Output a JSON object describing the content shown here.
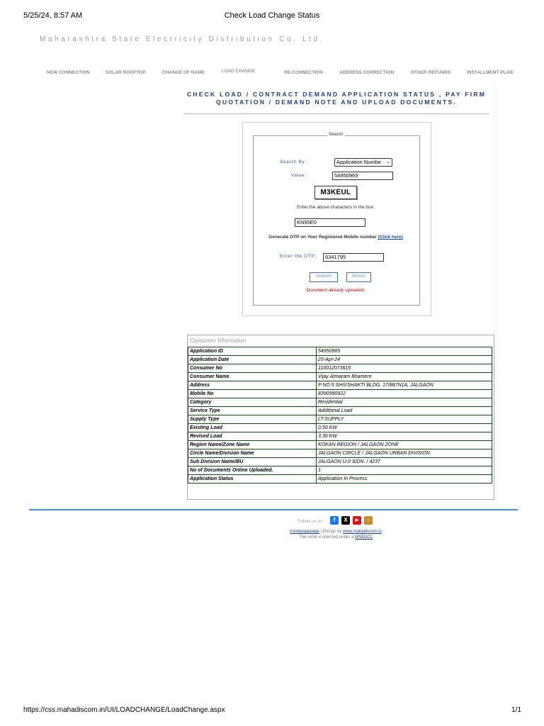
{
  "print_header": {
    "datetime": "5/25/24, 8:57 AM",
    "title": "Check Load Change Status"
  },
  "org_name": "Maharashtra State Electricity Distribution Co. Ltd.",
  "nav": [
    "NEW CONNECTION",
    "SOLAR ROOFTOP",
    "CHANGE OF NAME",
    "LOAD CHANGE",
    "RE-CONNECTION",
    "ADDRESS CORRECTION",
    "OTHER REFUNDS",
    "INSTALLMENT PLAN"
  ],
  "heading": {
    "line1": "CHECK LOAD / CONTRACT DEMAND APPLICATION STATUS , PAY FIRM",
    "line2": "QUOTATION / DEMAND NOTE AND UPLOAD DOCUMENTS."
  },
  "search": {
    "legend": "Search",
    "search_by_label": "Search By :",
    "search_by_value": "Application Numbe",
    "value_label": "Value :",
    "value": "54950965",
    "captcha": "M3KEUL",
    "captcha_hint": "Enter the above characters in the box.",
    "captcha_value": "KN95E0",
    "otp_text": "Generate OTP on Your Registered Mobile number",
    "otp_link": "(Click here)",
    "otp_label": "Enter the OTP:",
    "otp_value": "6341795",
    "submit": "Submit",
    "reset": "Reset",
    "error": "Document already uploaded."
  },
  "consumer": {
    "title": "Consumer Information",
    "rows": [
      {
        "k": "Application ID",
        "v": "54950965"
      },
      {
        "k": "Application Date",
        "v": "23-Apr-24"
      },
      {
        "k": "Consumer No",
        "v": "110012073615"
      },
      {
        "k": "Consumer Name",
        "v": "Vijay Atmaram Bhamere"
      },
      {
        "k": "Address",
        "v": "P NO 5 SHIVSHAKTI BLDG. 17/887N1A, JALGAON"
      },
      {
        "k": "Mobile No",
        "v": "8390990922"
      },
      {
        "k": "Category",
        "v": "Residential"
      },
      {
        "k": "Service Type",
        "v": "Additional Load"
      },
      {
        "k": "Supply Type",
        "v": "LT-SUPPLY"
      },
      {
        "k": "Existing Load",
        "v": "0.50 KW"
      },
      {
        "k": "Revised Load",
        "v": "3.30 KW"
      },
      {
        "k": "Region Name/Zone Name",
        "v": "KOKAN REGION / JALGAON ZONE"
      },
      {
        "k": "Circle Name/Division Name",
        "v": "JALGAON CIRCLE / JALGAON URBAN DIVISION"
      },
      {
        "k": "Sub Division Name/BU",
        "v": "JALGAON U-II S/DN. / 4237"
      },
      {
        "k": "No of Documents Online Uploaded.",
        "v": "1"
      },
      {
        "k": "Application Status",
        "v": "Application In Process"
      }
    ]
  },
  "footer": {
    "follow": "Follow us on",
    "homepage": "homepagepage",
    "design_by": "| Design by",
    "design_link": "www.mahadiscom.in",
    "license_text": "This work is licensed under a",
    "license_link": "MSEDCL"
  },
  "print_footer": {
    "url": "https://css.mahadiscom.in/UI/LOADCHANGE/LoadChange.aspx",
    "page": "1/1"
  }
}
